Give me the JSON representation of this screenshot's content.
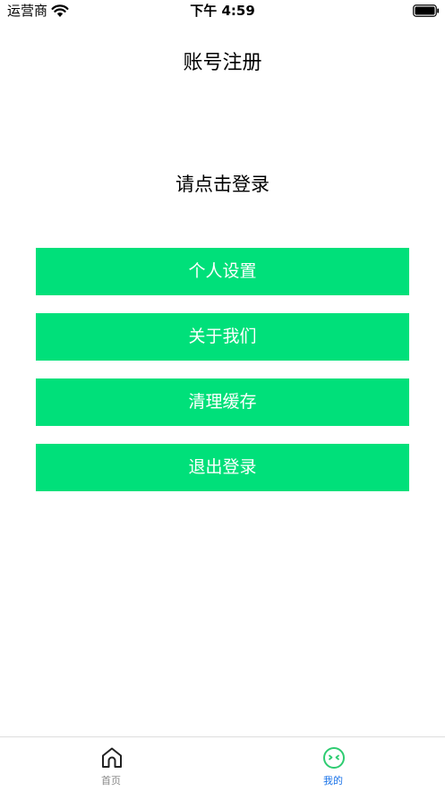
{
  "status_bar": {
    "carrier": "运营商",
    "time": "下午 4:59"
  },
  "header": {
    "title": "账号注册"
  },
  "main": {
    "login_prompt": "请点击登录",
    "buttons": [
      {
        "label": "个人设置"
      },
      {
        "label": "关于我们"
      },
      {
        "label": "清理缓存"
      },
      {
        "label": "退出登录"
      }
    ]
  },
  "tab_bar": {
    "tabs": [
      {
        "label": "首页",
        "icon": "home-icon"
      },
      {
        "label": "我的",
        "icon": "smiley-icon"
      }
    ],
    "active_tab": "我的"
  },
  "colors": {
    "button_background": "#00e07a",
    "button_text": "#ffffff",
    "tab_active": "#1a73e8",
    "tab_inactive": "#8a8a8a",
    "smiley_icon": "#2ecc71"
  }
}
